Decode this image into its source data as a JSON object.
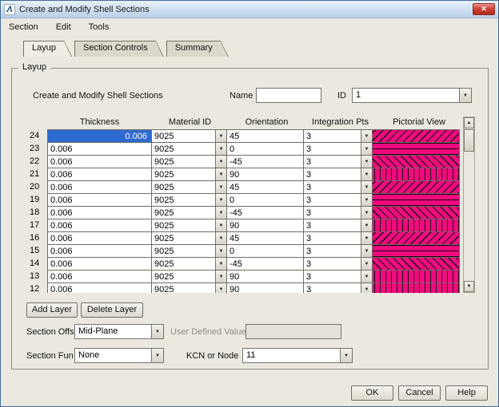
{
  "window": {
    "title": "Create and Modify Shell Sections"
  },
  "menu": {
    "items": [
      "Section",
      "Edit",
      "Tools"
    ]
  },
  "tabs": {
    "layup": "Layup",
    "section_controls": "Section Controls",
    "summary": "Summary"
  },
  "layup": {
    "group_title": "Layup",
    "heading": "Create and Modify Shell Sections",
    "name_label": "Name",
    "name_value": "",
    "id_label": "ID",
    "id_value": "1",
    "table": {
      "headers": {
        "thickness": "Thickness",
        "material": "Material ID",
        "orientation": "Orientation",
        "integration": "Integration Pts",
        "pictorial": "Pictorial View"
      },
      "rows": [
        {
          "layer": "24",
          "thickness": "0.006",
          "material_id": "9025",
          "orientation": "45",
          "integration_pts": "3",
          "selected": true
        },
        {
          "layer": "23",
          "thickness": "0.006",
          "material_id": "9025",
          "orientation": "0",
          "integration_pts": "3"
        },
        {
          "layer": "22",
          "thickness": "0.006",
          "material_id": "9025",
          "orientation": "-45",
          "integration_pts": "3"
        },
        {
          "layer": "21",
          "thickness": "0.006",
          "material_id": "9025",
          "orientation": "90",
          "integration_pts": "3"
        },
        {
          "layer": "20",
          "thickness": "0.006",
          "material_id": "9025",
          "orientation": "45",
          "integration_pts": "3"
        },
        {
          "layer": "19",
          "thickness": "0.006",
          "material_id": "9025",
          "orientation": "0",
          "integration_pts": "3"
        },
        {
          "layer": "18",
          "thickness": "0.006",
          "material_id": "9025",
          "orientation": "-45",
          "integration_pts": "3"
        },
        {
          "layer": "17",
          "thickness": "0.006",
          "material_id": "9025",
          "orientation": "90",
          "integration_pts": "3"
        },
        {
          "layer": "16",
          "thickness": "0.006",
          "material_id": "9025",
          "orientation": "45",
          "integration_pts": "3"
        },
        {
          "layer": "15",
          "thickness": "0.006",
          "material_id": "9025",
          "orientation": "0",
          "integration_pts": "3"
        },
        {
          "layer": "14",
          "thickness": "0.006",
          "material_id": "9025",
          "orientation": "-45",
          "integration_pts": "3"
        },
        {
          "layer": "13",
          "thickness": "0.006",
          "material_id": "9025",
          "orientation": "90",
          "integration_pts": "3"
        },
        {
          "layer": "12",
          "thickness": "0.006",
          "material_id": "9025",
          "orientation": "90",
          "integration_pts": "3"
        }
      ]
    },
    "add_layer_label": "Add Layer",
    "delete_layer_label": "Delete Layer",
    "section_offset_label": "Section Offs",
    "section_offset_value": "Mid-Plane",
    "user_defined_label": "User Defined Value",
    "user_defined_value": "",
    "section_function_label": "Section Fun",
    "section_function_value": "None",
    "kcn_label": "KCN or Node",
    "kcn_value": "11"
  },
  "footer": {
    "ok_label": "OK",
    "cancel_label": "Cancel",
    "help_label": "Help"
  },
  "colors": {
    "pictorial_pink": "#f10980",
    "hatch_line": "#16000b",
    "selection_blue": "#2e6bd0"
  }
}
